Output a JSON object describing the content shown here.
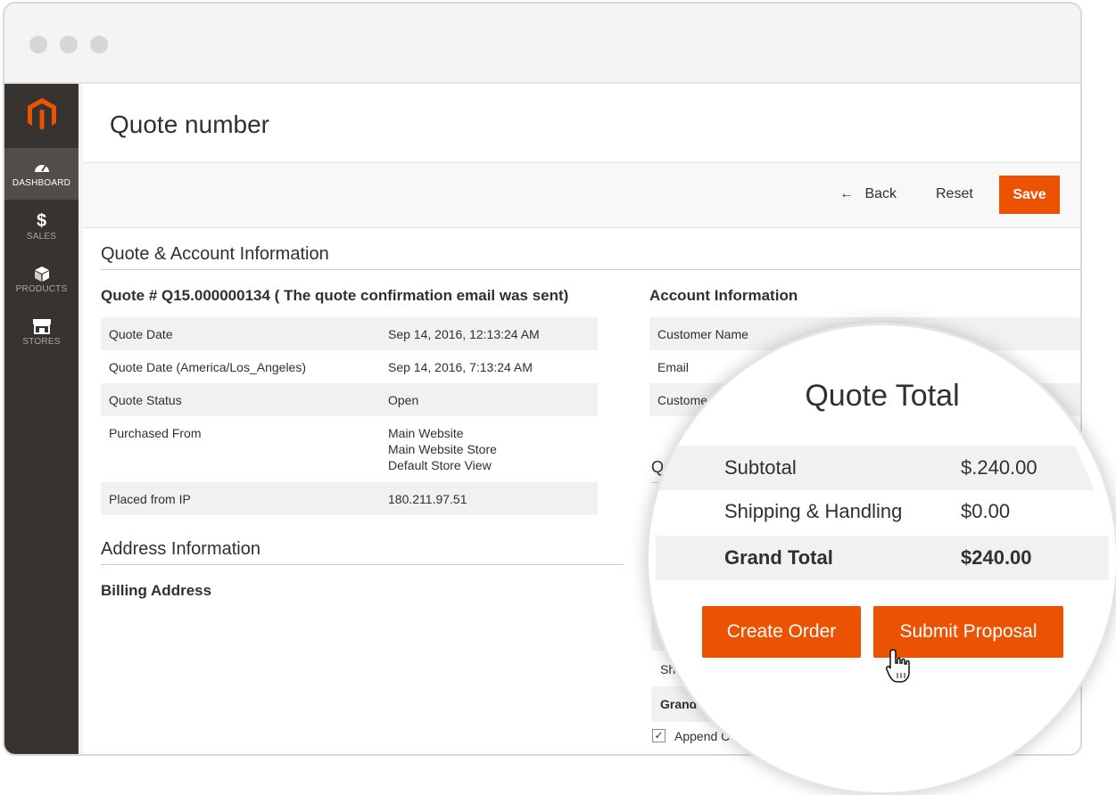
{
  "colors": {
    "accent": "#eb5202",
    "sidebar": "#373330",
    "sidebar_active": "#524d49"
  },
  "sidebar": {
    "items": [
      {
        "label": "DASHBOARD",
        "icon": "dashboard-icon",
        "active": true
      },
      {
        "label": "SALES",
        "icon": "dollar-icon",
        "active": false
      },
      {
        "label": "PRODUCTS",
        "icon": "cube-icon",
        "active": false
      },
      {
        "label": "STORES",
        "icon": "store-icon",
        "active": false
      }
    ],
    "sales_glyph": "$"
  },
  "header": {
    "title": "Quote number"
  },
  "toolbar": {
    "back_label": "Back",
    "back_arrow": "←",
    "reset_label": "Reset",
    "save_label": "Save"
  },
  "quote_section": {
    "title": "Quote & Account Information",
    "quote_heading": "Quote # Q15.000000134 ( The quote confirmation email was sent)",
    "rows": [
      {
        "label": "Quote Date",
        "value": "Sep 14, 2016, 12:13:24 AM"
      },
      {
        "label": "Quote Date (America/Los_Angeles)",
        "value": "Sep 14, 2016, 7:13:24 AM"
      },
      {
        "label": "Quote Status",
        "value": "Open"
      },
      {
        "label": "Purchased From",
        "value_lines": [
          "Main Website",
          "Main Website Store",
          "Default Store View"
        ]
      },
      {
        "label": "Placed from IP",
        "value": "180.211.97.51"
      }
    ]
  },
  "account": {
    "heading": "Account Information",
    "rows": [
      "Customer Name",
      "Email",
      "Custome"
    ]
  },
  "address": {
    "title": "Address Information",
    "billing_heading": "Billing Address"
  },
  "peek": {
    "q_letter": "Q",
    "sh": "Shi",
    "grand": "Grand",
    "append": "Append C",
    "check": "✓"
  },
  "quote_total": {
    "title": "Quote Total",
    "subtotal_label": "Subtotal",
    "subtotal_value": "$.240.00",
    "shipping_label": "Shipping & Handling",
    "shipping_value": "$0.00",
    "grand_label": "Grand Total",
    "grand_value": "$240.00",
    "create_order_label": "Create Order",
    "submit_proposal_label": "Submit Proposal"
  }
}
